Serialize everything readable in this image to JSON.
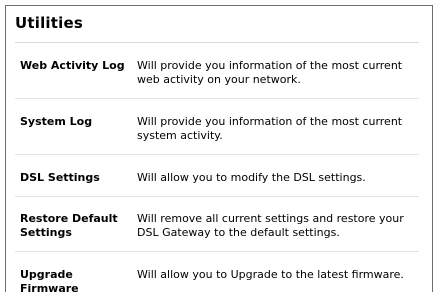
{
  "page": {
    "title": "Utilities"
  },
  "items": [
    {
      "name": "Web Activity Log",
      "description": "Will provide you information of the most current web activity on your network."
    },
    {
      "name": "System Log",
      "description": "Will provide you information of the most current system activity."
    },
    {
      "name": "DSL Settings",
      "description": "Will allow you to modify the DSL settings."
    },
    {
      "name": "Restore Default Settings",
      "description": "Will remove all current settings and restore your DSL Gateway to the default settings."
    },
    {
      "name": "Upgrade Firmware",
      "description": "Will allow you to Upgrade to the latest firmware."
    }
  ]
}
